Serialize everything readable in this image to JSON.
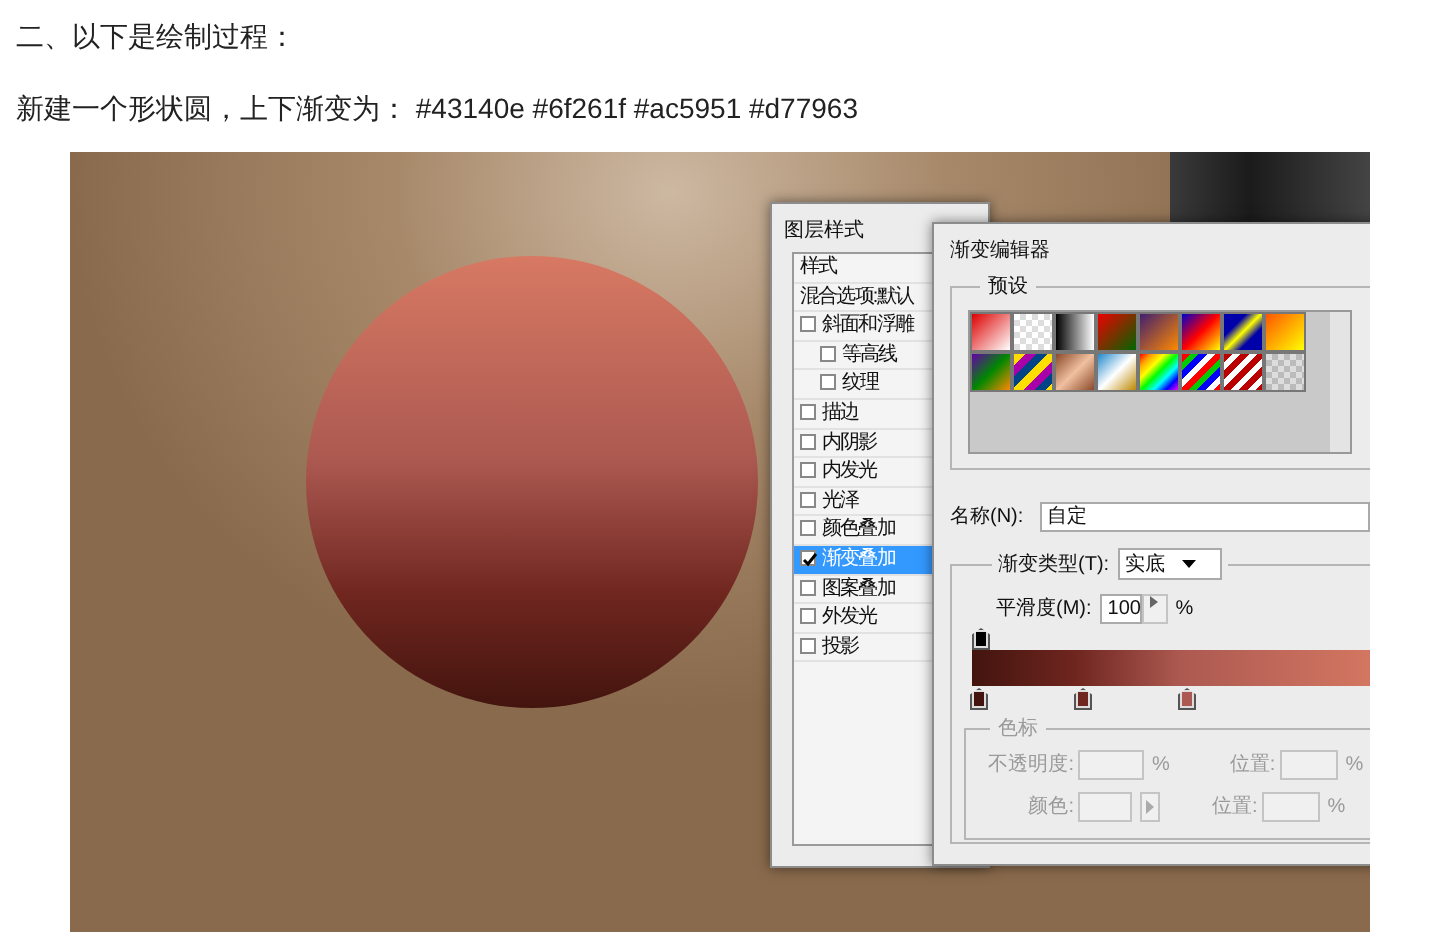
{
  "article": {
    "heading": "二、以下是绘制过程：",
    "intro": "新建一个形状圆，上下渐变为： #43140e #6f261f #ac5951 #d77963"
  },
  "layer_style": {
    "title": "图层样式",
    "header": "样式",
    "blend_options": "混合选项:默认",
    "effects": [
      {
        "label": "斜面和浮雕",
        "checked": false,
        "selected": false,
        "children": [
          {
            "label": "等高线",
            "checked": false,
            "selected": false
          },
          {
            "label": "纹理",
            "checked": false,
            "selected": false
          }
        ]
      },
      {
        "label": "描边",
        "checked": false,
        "selected": false
      },
      {
        "label": "内阴影",
        "checked": false,
        "selected": false
      },
      {
        "label": "内发光",
        "checked": false,
        "selected": false
      },
      {
        "label": "光泽",
        "checked": false,
        "selected": false
      },
      {
        "label": "颜色叠加",
        "checked": false,
        "selected": false
      },
      {
        "label": "渐变叠加",
        "checked": true,
        "selected": true
      },
      {
        "label": "图案叠加",
        "checked": false,
        "selected": false
      },
      {
        "label": "外发光",
        "checked": false,
        "selected": false
      },
      {
        "label": "投影",
        "checked": false,
        "selected": false
      }
    ]
  },
  "gradient_editor": {
    "title": "渐变编辑器",
    "presets_label": "预设",
    "name_label": "名称(N):",
    "name_value": "自定",
    "type_label": "渐变类型(T):",
    "type_value": "实底",
    "smoothness_label": "平滑度(M):",
    "smoothness_value": "100",
    "smoothness_unit": "%",
    "color_stops": [
      {
        "color": "#43140e"
      },
      {
        "color": "#6f261f"
      },
      {
        "color": "#ac5951"
      }
    ],
    "stops_group": {
      "title": "色标",
      "disabled": true,
      "opacity_label": "不透明度:",
      "opacity_unit": "%",
      "location_label": "位置:",
      "location_unit": "%",
      "color_label": "颜色:",
      "location2_label": "位置:",
      "location2_unit": "%"
    }
  }
}
